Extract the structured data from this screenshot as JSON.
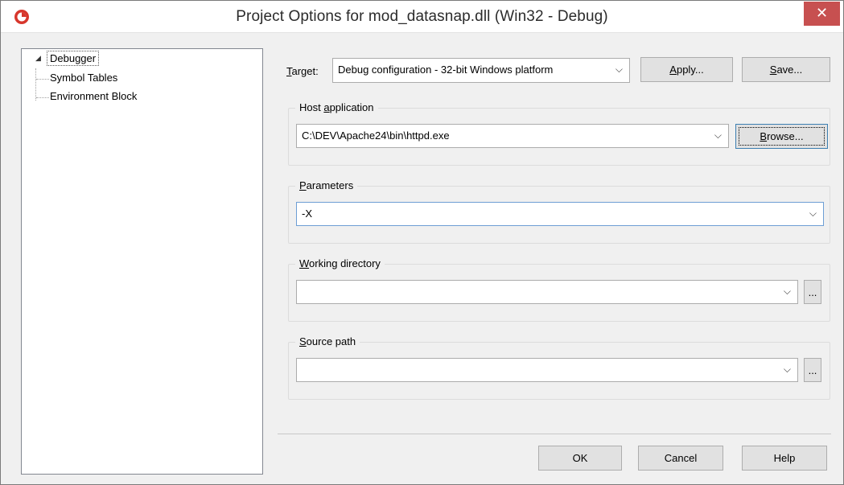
{
  "window": {
    "title": "Project Options for mod_datasnap.dll  (Win32 - Debug)",
    "close_glyph": "✕",
    "close_color": "#c75050"
  },
  "tree": {
    "expand_glyph": "◢",
    "root": "Debugger",
    "children": [
      "Symbol Tables",
      "Environment Block"
    ]
  },
  "target": {
    "label_u": "T",
    "label_rest": "arget:",
    "value": "Debug configuration - 32-bit Windows platform",
    "apply_u": "A",
    "apply_rest": "pply...",
    "save_u": "S",
    "save_rest": "ave..."
  },
  "host": {
    "title_pre": "Host ",
    "title_u": "a",
    "title_rest": "pplication",
    "value": "C:\\DEV\\Apache24\\bin\\httpd.exe",
    "browse_u": "B",
    "browse_rest": "rowse..."
  },
  "parameters": {
    "title_u": "P",
    "title_rest": "arameters",
    "value": "-X"
  },
  "working_dir": {
    "title_u": "W",
    "title_rest": "orking directory",
    "value": "",
    "ellipsis": "..."
  },
  "source_path": {
    "title_u": "S",
    "title_rest": "ource path",
    "value": "",
    "ellipsis": "..."
  },
  "footer": {
    "ok": "OK",
    "cancel": "Cancel",
    "help": "Help"
  },
  "icons": {
    "dropdown": "chevron-down-icon",
    "dropdown_glyph": "⌵"
  }
}
